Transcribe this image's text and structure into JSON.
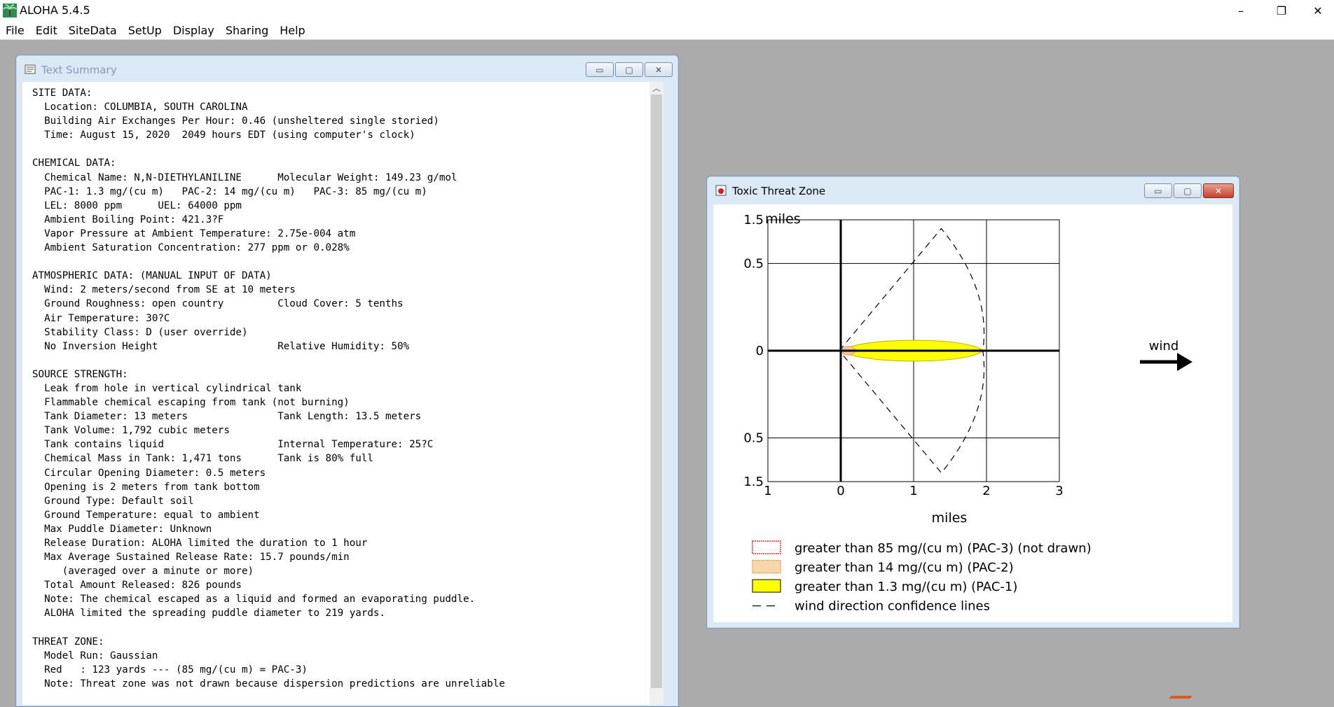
{
  "app": {
    "title": "ALOHA 5.4.5",
    "menu": [
      "File",
      "Edit",
      "SiteData",
      "SetUp",
      "Display",
      "Sharing",
      "Help"
    ],
    "window_controls": {
      "minimize": "–",
      "restore": "❐",
      "close": "✕"
    }
  },
  "text_window": {
    "title": "Text Summary",
    "lines": [
      "SITE DATA:",
      "  Location: COLUMBIA, SOUTH CAROLINA",
      "  Building Air Exchanges Per Hour: 0.46 (unsheltered single storied)",
      "  Time: August 15, 2020  2049 hours EDT (using computer's clock)",
      "",
      "CHEMICAL DATA:",
      "  Chemical Name: N,N-DIETHYLANILINE      Molecular Weight: 149.23 g/mol",
      "  PAC-1: 1.3 mg/(cu m)   PAC-2: 14 mg/(cu m)   PAC-3: 85 mg/(cu m)",
      "  LEL: 8000 ppm      UEL: 64000 ppm",
      "  Ambient Boiling Point: 421.3?F",
      "  Vapor Pressure at Ambient Temperature: 2.75e-004 atm",
      "  Ambient Saturation Concentration: 277 ppm or 0.028%",
      "",
      "ATMOSPHERIC DATA: (MANUAL INPUT OF DATA)",
      "  Wind: 2 meters/second from SE at 10 meters",
      "  Ground Roughness: open country         Cloud Cover: 5 tenths",
      "  Air Temperature: 30?C",
      "  Stability Class: D (user override)",
      "  No Inversion Height                    Relative Humidity: 50%",
      "",
      "SOURCE STRENGTH:",
      "  Leak from hole in vertical cylindrical tank",
      "  Flammable chemical escaping from tank (not burning)",
      "  Tank Diameter: 13 meters               Tank Length: 13.5 meters",
      "  Tank Volume: 1,792 cubic meters",
      "  Tank contains liquid                   Internal Temperature: 25?C",
      "  Chemical Mass in Tank: 1,471 tons      Tank is 80% full",
      "  Circular Opening Diameter: 0.5 meters",
      "  Opening is 2 meters from tank bottom",
      "  Ground Type: Default soil",
      "  Ground Temperature: equal to ambient",
      "  Max Puddle Diameter: Unknown",
      "  Release Duration: ALOHA limited the duration to 1 hour",
      "  Max Average Sustained Release Rate: 15.7 pounds/min",
      "     (averaged over a minute or more)",
      "  Total Amount Released: 826 pounds",
      "  Note: The chemical escaped as a liquid and formed an evaporating puddle.",
      "  ALOHA limited the spreading puddle diameter to 219 yards.",
      "",
      "THREAT ZONE:",
      "  Model Run: Gaussian",
      "  Red   : 123 yards --- (85 mg/(cu m) = PAC-3)",
      "  Note: Threat zone was not drawn because dispersion predictions are unreliable"
    ]
  },
  "threat_window": {
    "title": "Toxic Threat Zone",
    "wind_label": "wind",
    "legend": [
      {
        "label": "greater than 85 mg/(cu m) (PAC-3) (not drawn)",
        "color": "#e03030"
      },
      {
        "label": "greater than 14 mg/(cu m) (PAC-2)",
        "color": "#f0a040"
      },
      {
        "label": "greater than 1.3 mg/(cu m) (PAC-1)",
        "color": "#ffff00"
      },
      {
        "label": "wind direction confidence lines",
        "color": "#000000"
      }
    ]
  },
  "chart_data": {
    "type": "area",
    "xlabel": "miles",
    "ylabel": "miles",
    "x_ticks": [
      "1",
      "0",
      "1",
      "2",
      "3"
    ],
    "y_ticks": [
      "1.5",
      "0.5",
      "0",
      "0.5",
      "1.5"
    ],
    "xlim": [
      -1,
      3
    ],
    "ylim": [
      -1.5,
      1.5
    ],
    "grid": true,
    "zones": [
      {
        "name": "PAC-1",
        "x_start": 0,
        "x_end": 1.95,
        "half_width": 0.12,
        "color": "#ffff00"
      },
      {
        "name": "PAC-2",
        "x_start": 0,
        "x_end": 0.2,
        "half_width": 0.05,
        "color": "#f0a040"
      }
    ],
    "confidence_lines": {
      "apex_x": -0.02,
      "far_x": 1.95,
      "tip_x": 1.38,
      "tip_y": 1.4
    }
  }
}
